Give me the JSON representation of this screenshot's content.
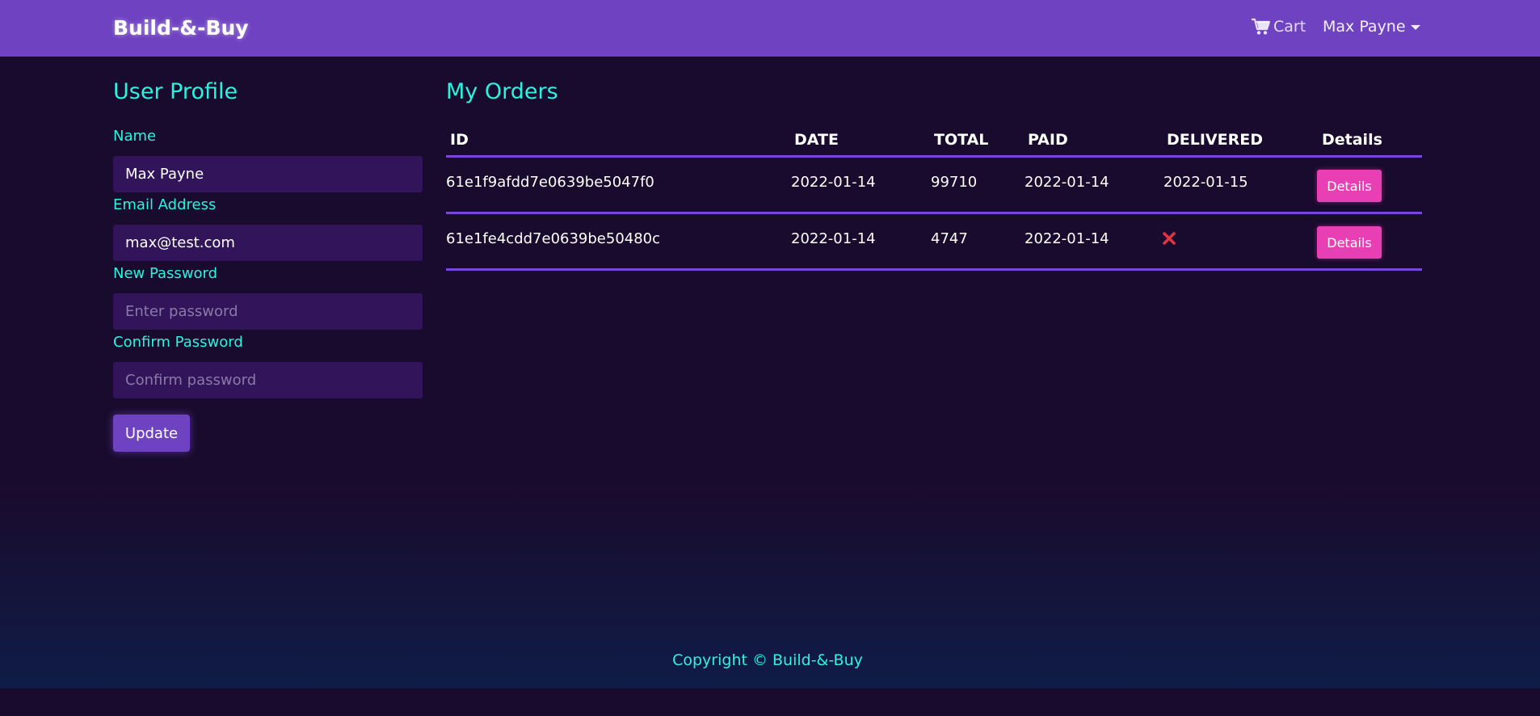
{
  "navbar": {
    "brand": "Build-&-Buy",
    "cart_label": "Cart",
    "cart_icon": "shopping-cart-icon",
    "user_label": "Max Payne",
    "user_caret_icon": "caret-down-icon"
  },
  "profile": {
    "title": "User Profile",
    "name_label": "Name",
    "name_value": "Max Payne",
    "email_label": "Email Address",
    "email_value": "max@test.com",
    "password_label": "New Password",
    "password_placeholder": "Enter password",
    "confirm_label": "Confirm Password",
    "confirm_placeholder": "Confirm password",
    "update_label": "Update"
  },
  "orders": {
    "title": "My Orders",
    "headers": [
      "ID",
      "DATE",
      "TOTAL",
      "PAID",
      "DELIVERED",
      "Details"
    ],
    "rows": [
      {
        "id": "61e1f9afdd7e0639be5047f0",
        "date": "2022-01-14",
        "total": "99710",
        "paid": "2022-01-14",
        "delivered": "2022-01-15",
        "details_label": "Details"
      },
      {
        "id": "61e1fe4cdd7e0639be50480c",
        "date": "2022-01-14",
        "total": "4747",
        "paid": "2022-01-14",
        "delivered": "",
        "delivered_icon": "x-mark-icon",
        "details_label": "Details"
      }
    ]
  },
  "footer": {
    "text": "Copyright © Build-&-Buy"
  },
  "colors": {
    "primary": "#6f42c1",
    "accent": "#2ef2de",
    "danger": "#dc3545",
    "details_button": "#e83fb5",
    "background": "#190b2d",
    "input_bg": "#32145a"
  }
}
